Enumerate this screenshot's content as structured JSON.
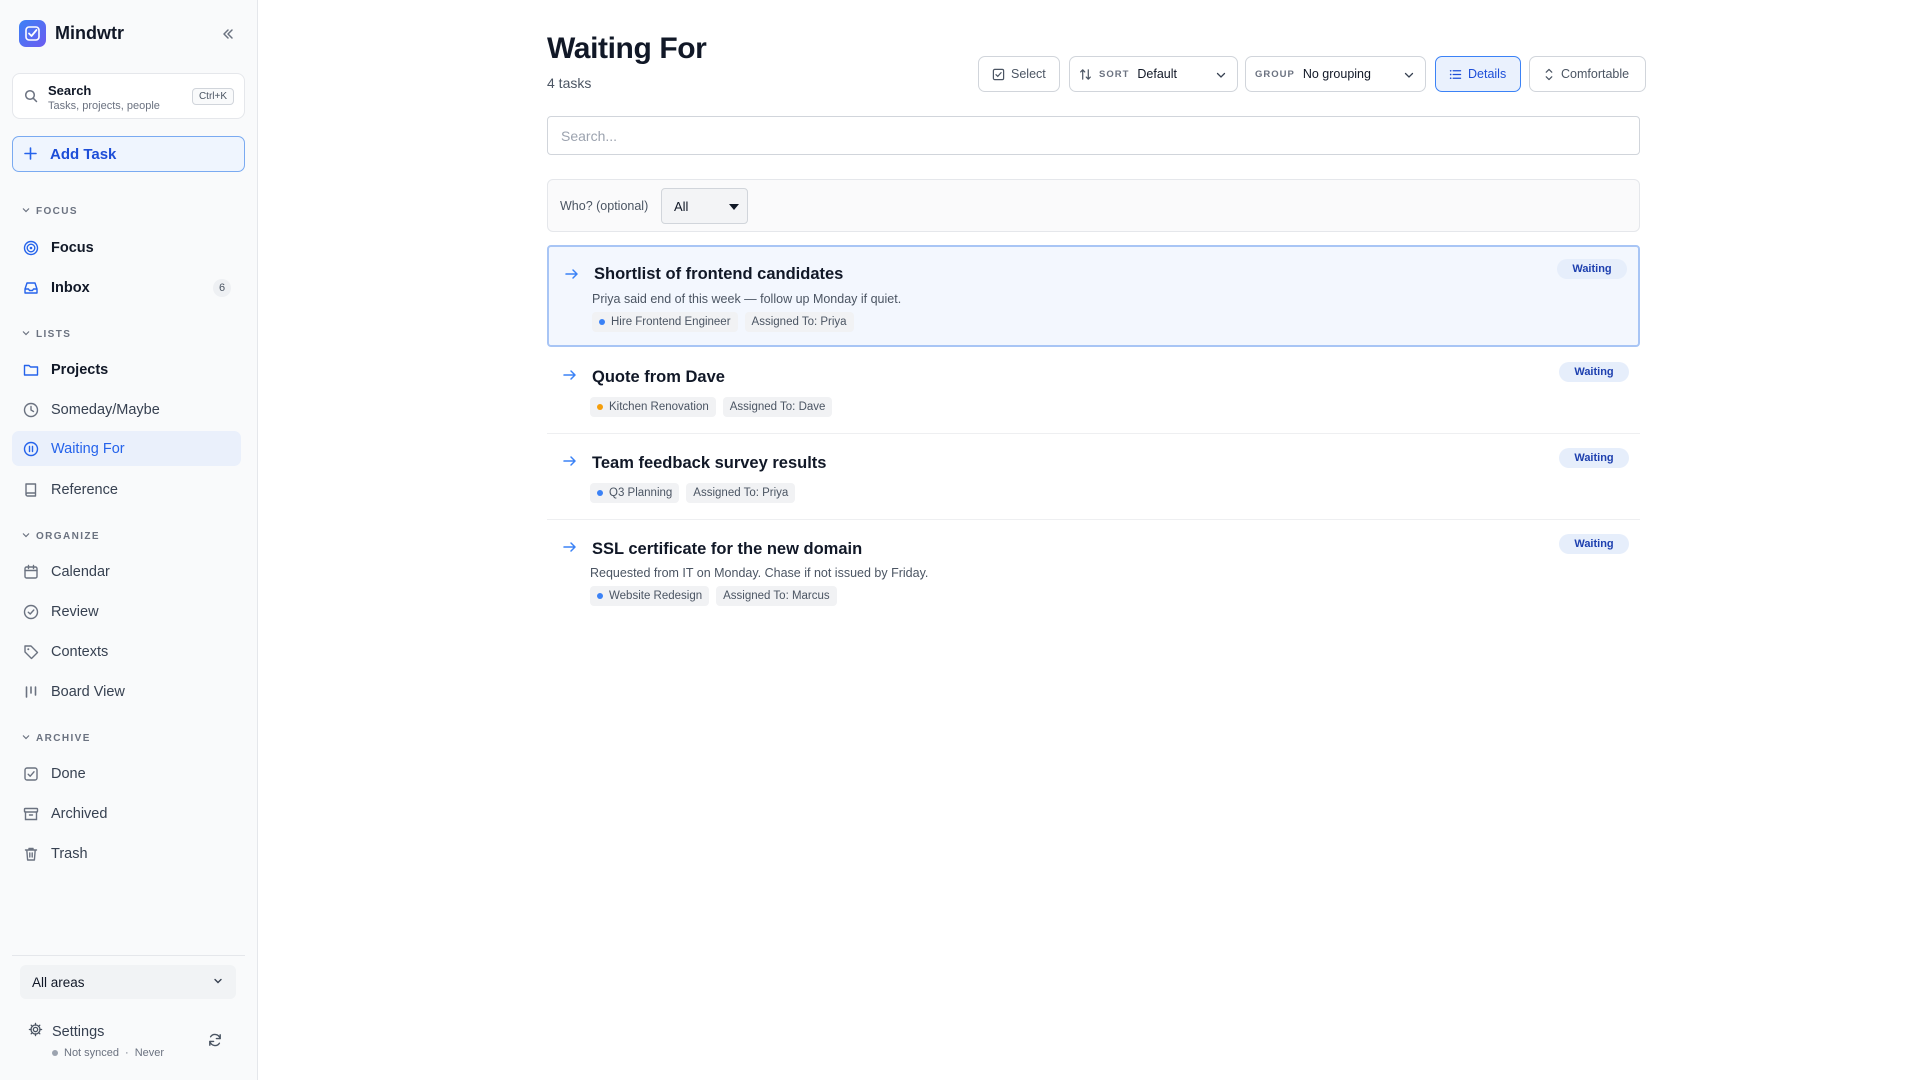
{
  "app": {
    "name": "Mindwtr"
  },
  "sidebar": {
    "search": {
      "title": "Search",
      "subtitle": "Tasks, projects, people",
      "shortcut": "Ctrl+K"
    },
    "add_task_label": "Add Task",
    "sections": {
      "focus": "FOCUS",
      "lists": "LISTS",
      "organize": "ORGANIZE",
      "archive": "ARCHIVE"
    },
    "items": {
      "focus": "Focus",
      "inbox": "Inbox",
      "inbox_count": "6",
      "projects": "Projects",
      "someday": "Someday/Maybe",
      "waiting": "Waiting For",
      "reference": "Reference",
      "calendar": "Calendar",
      "review": "Review",
      "contexts": "Contexts",
      "board": "Board View",
      "done": "Done",
      "archived": "Archived",
      "trash": "Trash"
    },
    "areas_selected": "All areas",
    "settings_label": "Settings",
    "sync_status": "Not synced",
    "sync_sep": "·",
    "sync_time": "Never"
  },
  "main": {
    "title": "Waiting For",
    "subtitle": "4 tasks",
    "toolbar": {
      "select_label": "Select",
      "sort_tag": "SORT",
      "sort_value": "Default",
      "group_tag": "GROUP",
      "group_value": "No grouping",
      "details_label": "Details",
      "density_label": "Comfortable"
    },
    "search_placeholder": "Search...",
    "filter": {
      "label": "Who? (optional)",
      "value": "All"
    },
    "tasks": [
      {
        "title": "Shortlist of frontend candidates",
        "note": "Priya said end of this week — follow up Monday if quiet.",
        "project": "Hire Frontend Engineer",
        "project_color": "#3b82f6",
        "assigned": "Assigned To: Priya",
        "status": "Waiting"
      },
      {
        "title": "Quote from Dave",
        "note": "",
        "project": "Kitchen Renovation",
        "project_color": "#f59e0b",
        "assigned": "Assigned To: Dave",
        "status": "Waiting"
      },
      {
        "title": "Team feedback survey results",
        "note": "",
        "project": "Q3 Planning",
        "project_color": "#3b82f6",
        "assigned": "Assigned To: Priya",
        "status": "Waiting"
      },
      {
        "title": "SSL certificate for the new domain",
        "note": "Requested from IT on Monday. Chase if not issued by Friday.",
        "project": "Website Redesign",
        "project_color": "#3b82f6",
        "assigned": "Assigned To: Marcus",
        "status": "Waiting"
      }
    ]
  },
  "colors": {
    "accent": "#2563eb",
    "active_bg": "#eaf0fb",
    "badge_bg": "#e6eefb"
  }
}
